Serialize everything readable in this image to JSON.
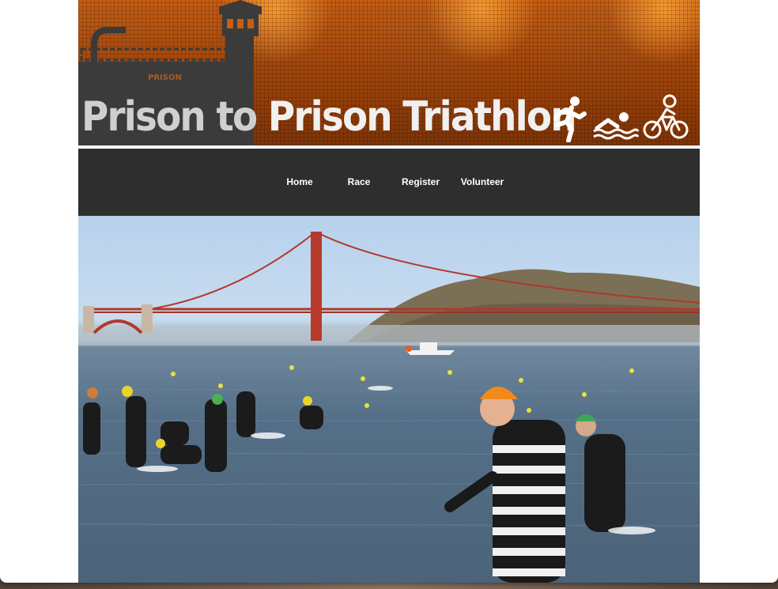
{
  "header": {
    "title_part1": "Prison to ",
    "title_part2": "Prison Triathlon",
    "banner_tower_label": "PRISON",
    "icons": [
      "run-icon",
      "swim-icon",
      "bike-icon"
    ],
    "colors": {
      "banner_orange": "#c65d12",
      "banner_dark": "#7c3408"
    }
  },
  "nav": {
    "items": [
      {
        "label": "Home"
      },
      {
        "label": "Race"
      },
      {
        "label": "Register"
      },
      {
        "label": "Volunteer"
      }
    ],
    "colors": {
      "background": "#2e2e2e",
      "text": "#ffffff"
    }
  },
  "hero": {
    "image": "photo-triathlon-swim-start-golden-gate-bridge",
    "colors": {
      "bridge": "#c0392b",
      "water": "#556f88",
      "sky": "#b7d1ec"
    }
  }
}
